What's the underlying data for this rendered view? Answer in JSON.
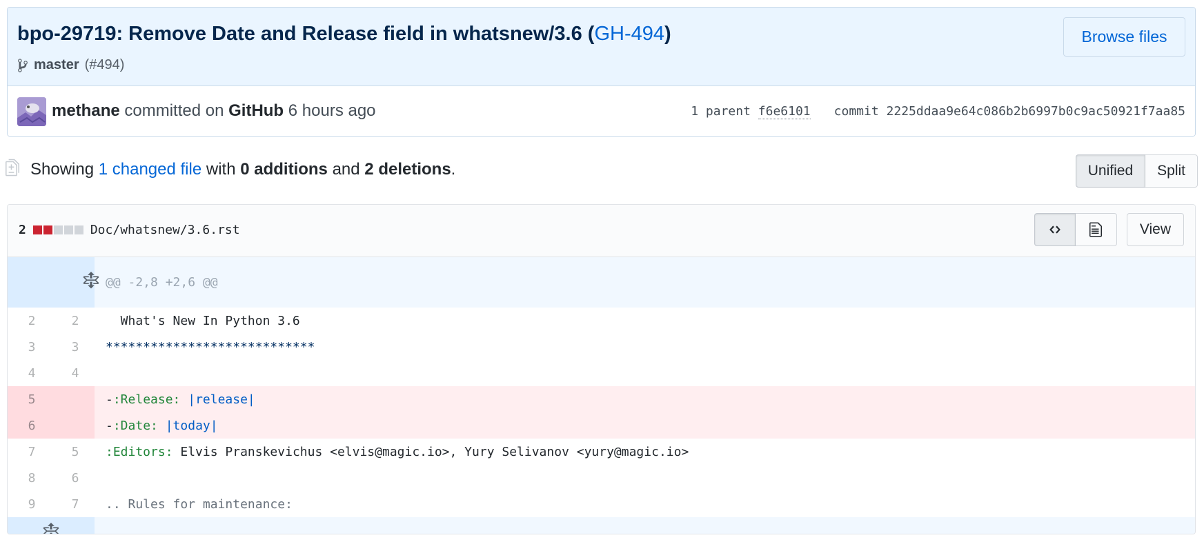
{
  "commit": {
    "title_prefix": "bpo-29719: Remove Date and Release field in whatsnew/3.6 (",
    "title_link": "GH-494",
    "title_suffix": ")",
    "branch": "master",
    "pr_ref": "(#494)",
    "browse_label": "Browse files",
    "author": "methane",
    "committed_text": "committed on",
    "platform": "GitHub",
    "time_ago": "6 hours ago",
    "parent_label": "1 parent",
    "parent_sha": "f6e6101",
    "commit_label": "commit",
    "commit_sha": "2225ddaa9e64c086b2b6997b0c9ac50921f7aa85"
  },
  "toc": {
    "showing": "Showing",
    "changed_files": "1 changed file",
    "with": "with",
    "additions": "0 additions",
    "and": "and",
    "deletions": "2 deletions",
    "period": ".",
    "unified_label": "Unified",
    "split_label": "Split"
  },
  "file": {
    "change_count": "2",
    "path": "Doc/whatsnew/3.6.rst",
    "view_label": "View",
    "colors": {
      "deleted_block": "#cb2431",
      "neutral_block": "#d1d5da"
    },
    "blocks": [
      "deleted",
      "deleted",
      "neutral",
      "neutral",
      "neutral"
    ],
    "hunk_header": "@@ -2,8 +2,6 @@",
    "lines": [
      {
        "old": "2",
        "new": "2",
        "type": "context",
        "text": "  What's New In Python 3.6"
      },
      {
        "old": "3",
        "new": "3",
        "type": "context",
        "text": "****************************"
      },
      {
        "old": "4",
        "new": "4",
        "type": "context",
        "text": ""
      },
      {
        "old": "5",
        "new": "",
        "type": "del",
        "text": "-:Release: |release|"
      },
      {
        "old": "6",
        "new": "",
        "type": "del",
        "text": "-:Date: |today|"
      },
      {
        "old": "7",
        "new": "5",
        "type": "context",
        "text": ":Editors: Elvis Pranskevichus <elvis@magic.io>, Yury Selivanov <yury@magic.io>"
      },
      {
        "old": "8",
        "new": "6",
        "type": "context",
        "text": ""
      },
      {
        "old": "9",
        "new": "7",
        "type": "context",
        "text": ".. Rules for maintenance:"
      }
    ]
  }
}
